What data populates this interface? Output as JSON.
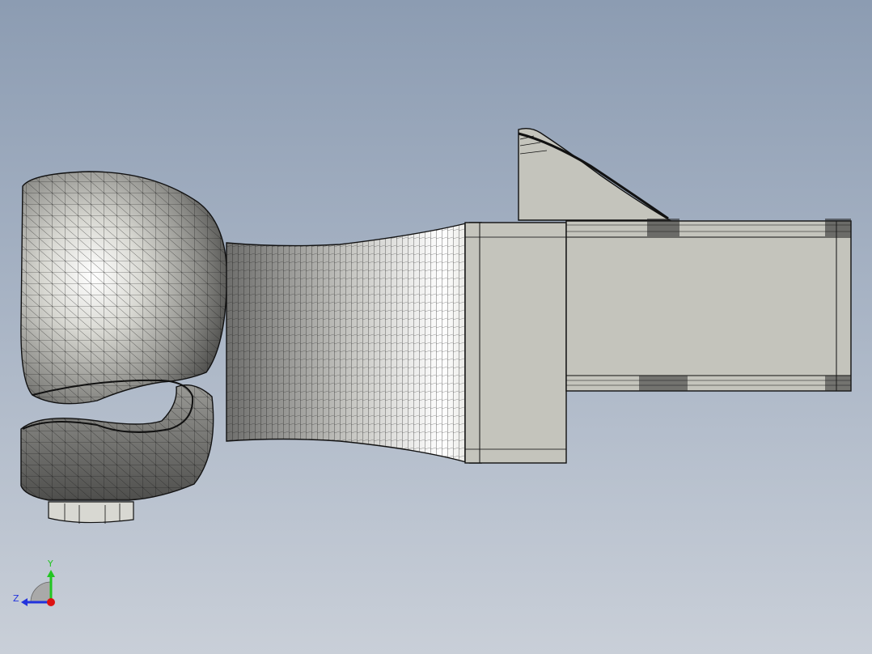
{
  "viewport": {
    "background_top": "#8c9cb2",
    "background_bottom": "#c9cfd8",
    "model": {
      "shaded_color": "#c4c4bc",
      "mesh_color": "#111111",
      "highlight_color": "#ffffff"
    }
  },
  "triad": {
    "y_label": "Y",
    "z_label": "Z",
    "y_color": "#22c522",
    "z_color": "#2233dd",
    "x_color": "#dd1111",
    "x_icon": "x-axis-dot-icon"
  }
}
